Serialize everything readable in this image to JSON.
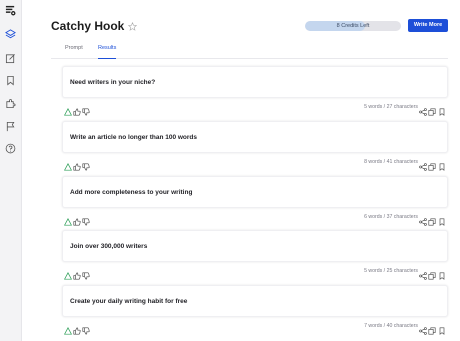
{
  "header": {
    "title": "Catchy Hook",
    "credits_label": "8 Credits Left",
    "credits_fraction": 0.62,
    "write_more_label": "Write More"
  },
  "tabs": [
    {
      "label": "Prompt",
      "active": false
    },
    {
      "label": "Results",
      "active": true
    }
  ],
  "sidebar": {
    "icons": [
      "logo-icon",
      "layers-icon",
      "edit-icon",
      "bookmark-icon",
      "puzzle-icon",
      "flag-icon",
      "help-icon"
    ]
  },
  "colors": {
    "accent": "#1d4fd8",
    "warning": "#2a9d55"
  },
  "results": [
    {
      "text": "Need writers in your niche?",
      "meta": "5 words / 27 characters"
    },
    {
      "text": "Write an article no longer than 100 words",
      "meta": "8 words / 41 characters"
    },
    {
      "text": "Add more completeness to your writing",
      "meta": "6 words / 37 characters"
    },
    {
      "text": "Join over 300,000 writers",
      "meta": "5 words / 25 characters"
    },
    {
      "text": "Create your daily writing habit for free",
      "meta": "7 words / 40 characters"
    }
  ]
}
